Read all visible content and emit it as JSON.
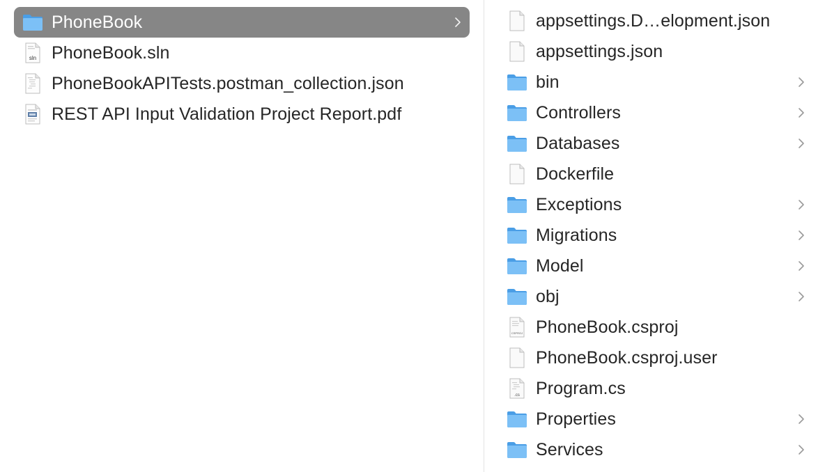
{
  "colors": {
    "selection": "#868686",
    "folder": "#5eaef0",
    "chevron": "#9a9a9a"
  },
  "left_column": {
    "items": [
      {
        "label": "PhoneBook",
        "kind": "folder",
        "selected": true,
        "has_children": true
      },
      {
        "label": "PhoneBook.sln",
        "kind": "sln-file",
        "badge": "sln"
      },
      {
        "label": "PhoneBookAPITests.postman_collection.json",
        "kind": "json-file"
      },
      {
        "label": "REST API Input Validation Project Report.pdf",
        "kind": "pdf-file"
      }
    ]
  },
  "right_column": {
    "items": [
      {
        "label": "appsettings.D…elopment.json",
        "kind": "blank-file"
      },
      {
        "label": "appsettings.json",
        "kind": "blank-file"
      },
      {
        "label": "bin",
        "kind": "folder",
        "has_children": true
      },
      {
        "label": "Controllers",
        "kind": "folder",
        "has_children": true
      },
      {
        "label": "Databases",
        "kind": "folder",
        "has_children": true
      },
      {
        "label": "Dockerfile",
        "kind": "blank-file"
      },
      {
        "label": "Exceptions",
        "kind": "folder",
        "has_children": true
      },
      {
        "label": "Migrations",
        "kind": "folder",
        "has_children": true
      },
      {
        "label": "Model",
        "kind": "folder",
        "has_children": true
      },
      {
        "label": "obj",
        "kind": "folder",
        "has_children": true
      },
      {
        "label": "PhoneBook.csproj",
        "kind": "csproj-file",
        "badge": "CSPROJ"
      },
      {
        "label": "PhoneBook.csproj.user",
        "kind": "blank-file"
      },
      {
        "label": "Program.cs",
        "kind": "cs-file",
        "badge": ".cs"
      },
      {
        "label": "Properties",
        "kind": "folder",
        "has_children": true
      },
      {
        "label": "Services",
        "kind": "folder",
        "has_children": true
      }
    ]
  }
}
